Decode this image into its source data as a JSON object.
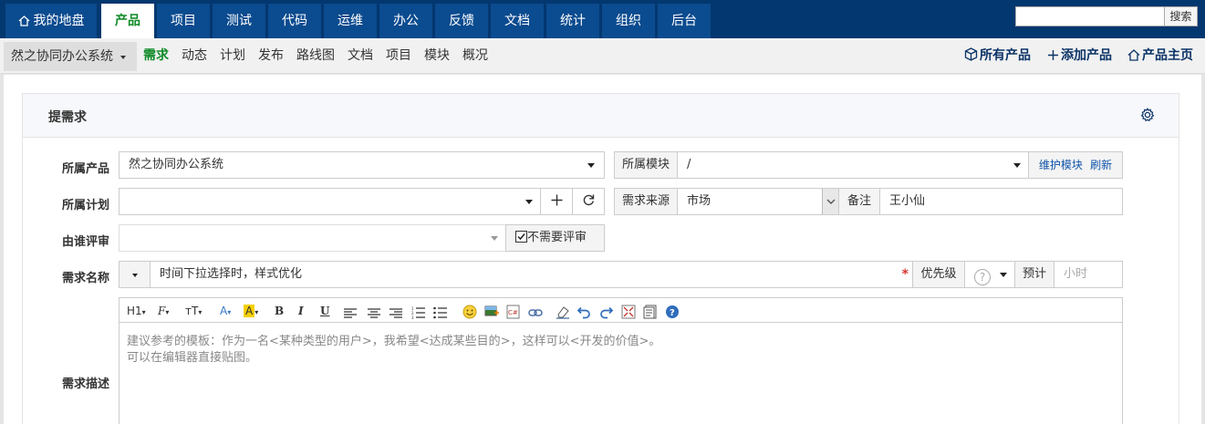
{
  "topnav": {
    "home": "我的地盘",
    "tabs": [
      "产品",
      "项目",
      "测试",
      "代码",
      "运维",
      "办公",
      "反馈",
      "文档",
      "统计",
      "组织",
      "后台"
    ],
    "active": "产品",
    "search_button": "搜索"
  },
  "subnav": {
    "product": "然之协同办公系统",
    "items": [
      "需求",
      "动态",
      "计划",
      "发布",
      "路线图",
      "文档",
      "项目",
      "模块",
      "概况"
    ],
    "active": "需求",
    "right": {
      "all_products": "所有产品",
      "add_product": "添加产品",
      "product_home": "产品主页"
    }
  },
  "form": {
    "title": "提需求",
    "product_label": "所属产品",
    "product_value": "然之协同办公系统",
    "module_label": "所属模块",
    "module_value": "/",
    "maintain_module": "维护模块",
    "refresh": "刷新",
    "plan_label": "所属计划",
    "plan_value": "",
    "source_label": "需求来源",
    "source_value": "市场",
    "note_label": "备注",
    "note_value": "王小仙",
    "reviewer_label": "由谁评审",
    "reviewer_value": "",
    "no_review": "不需要评审",
    "no_review_checked": true,
    "name_label": "需求名称",
    "name_value": "时间下拉选择时，样式优化",
    "required_mark": "*",
    "priority_label": "优先级",
    "priority_value": "?",
    "estimate_label": "预计",
    "estimate_placeholder": "小时",
    "desc_label": "需求描述",
    "desc_placeholder_line1": "建议参考的模板：作为一名<某种类型的用户>，我希望<达成某些目的>，这样可以<开发的价值>。",
    "desc_placeholder_line2": "可以在编辑器直接贴图。"
  },
  "editor_toolbar": {
    "heading": "H1",
    "font": "F",
    "font_size": "тT",
    "font_color": "A",
    "bg_color": "A",
    "bold": "B",
    "italic": "I",
    "underline": "U"
  },
  "colors": {
    "topbar": "#03376f",
    "tab": "#0b4b8f",
    "active_green": "#0f8a27",
    "link_blue": "#1155aa",
    "required": "#d9362e"
  }
}
